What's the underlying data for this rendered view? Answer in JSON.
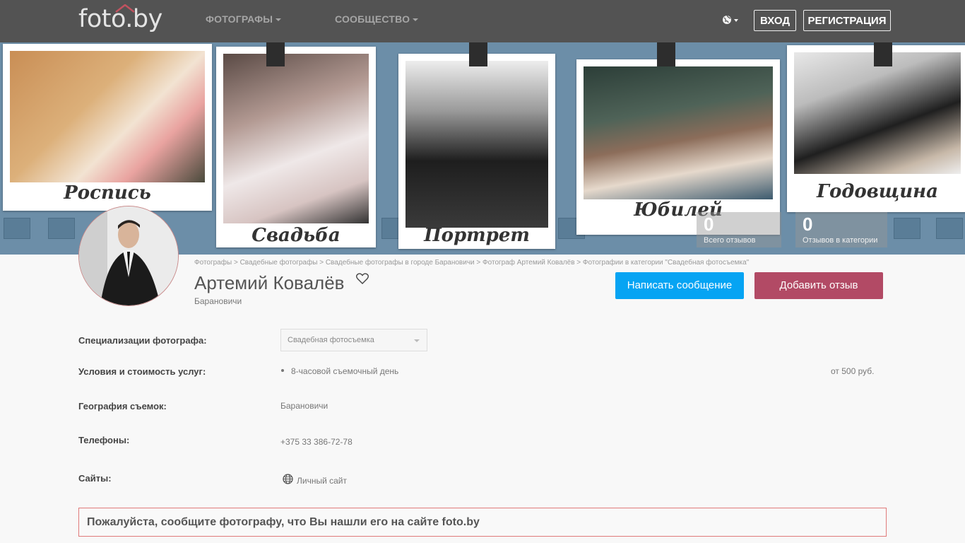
{
  "header": {
    "logo": "foto.by",
    "nav": [
      "ФОТОГРАФЫ",
      "СООБЩЕСТВО"
    ],
    "login": "ВХОД",
    "register": "РЕГИСТРАЦИЯ"
  },
  "banner": {
    "captions": [
      "Роспись",
      "Свадьба",
      "Портрет",
      "Юбилей",
      "Годовщина"
    ],
    "stats": [
      {
        "value": "0",
        "label": "Всего отзывов"
      },
      {
        "value": "0",
        "label": "Отзывов в категории"
      }
    ]
  },
  "breadcrumb": [
    "Фотографы",
    "Свадебные фотографы",
    "Свадебные фотографы в городе Барановичи",
    "Фотограф Артемий Ковалёв",
    "Фотографии в категории \"Свадебная фотосъемка\""
  ],
  "profile": {
    "name": "Артемий Ковалёв",
    "city": "Барановичи",
    "message_button": "Написать сообщение",
    "review_button": "Добавить отзыв"
  },
  "details": {
    "specializations_label": "Специализации фотографа:",
    "specialization_selected": "Свадебная фотосъемка",
    "services_label": "Условия и стоимость услуг:",
    "service_name": "8-часовой съемочный день",
    "service_price": "от 500 руб.",
    "geography_label": "География съемок:",
    "geography_value": "Барановичи",
    "phones_label": "Телефоны:",
    "phone_value": "+375 33 386-72-78",
    "sites_label": "Сайты:",
    "site_link": "Личный сайт"
  },
  "notice": "Пожалуйста, сообщите фотографу, что Вы нашли его на сайте foto.by"
}
